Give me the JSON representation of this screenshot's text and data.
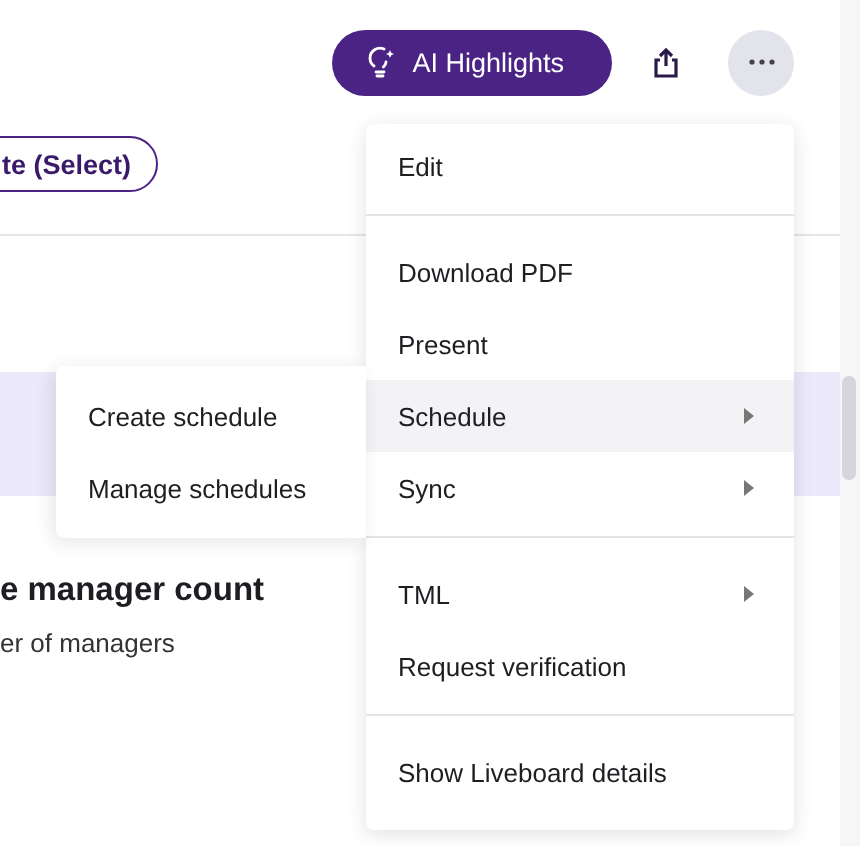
{
  "header": {
    "ai_button": "AI Highlights"
  },
  "filter_chip": "te (Select)",
  "card": {
    "title": "e manager count",
    "subtitle": "er of managers"
  },
  "menu": {
    "groups": [
      [
        {
          "label": "Edit",
          "has_submenu": false,
          "selected": false
        }
      ],
      [
        {
          "label": "Download PDF",
          "has_submenu": false,
          "selected": false
        },
        {
          "label": "Present",
          "has_submenu": false,
          "selected": false
        },
        {
          "label": "Schedule",
          "has_submenu": true,
          "selected": true
        },
        {
          "label": "Sync",
          "has_submenu": true,
          "selected": false
        }
      ],
      [
        {
          "label": "TML",
          "has_submenu": true,
          "selected": false
        },
        {
          "label": "Request verification",
          "has_submenu": false,
          "selected": false
        }
      ],
      [
        {
          "label": "Show Liveboard details",
          "has_submenu": false,
          "selected": false
        }
      ]
    ]
  },
  "submenu": [
    "Create schedule",
    "Manage schedules"
  ]
}
